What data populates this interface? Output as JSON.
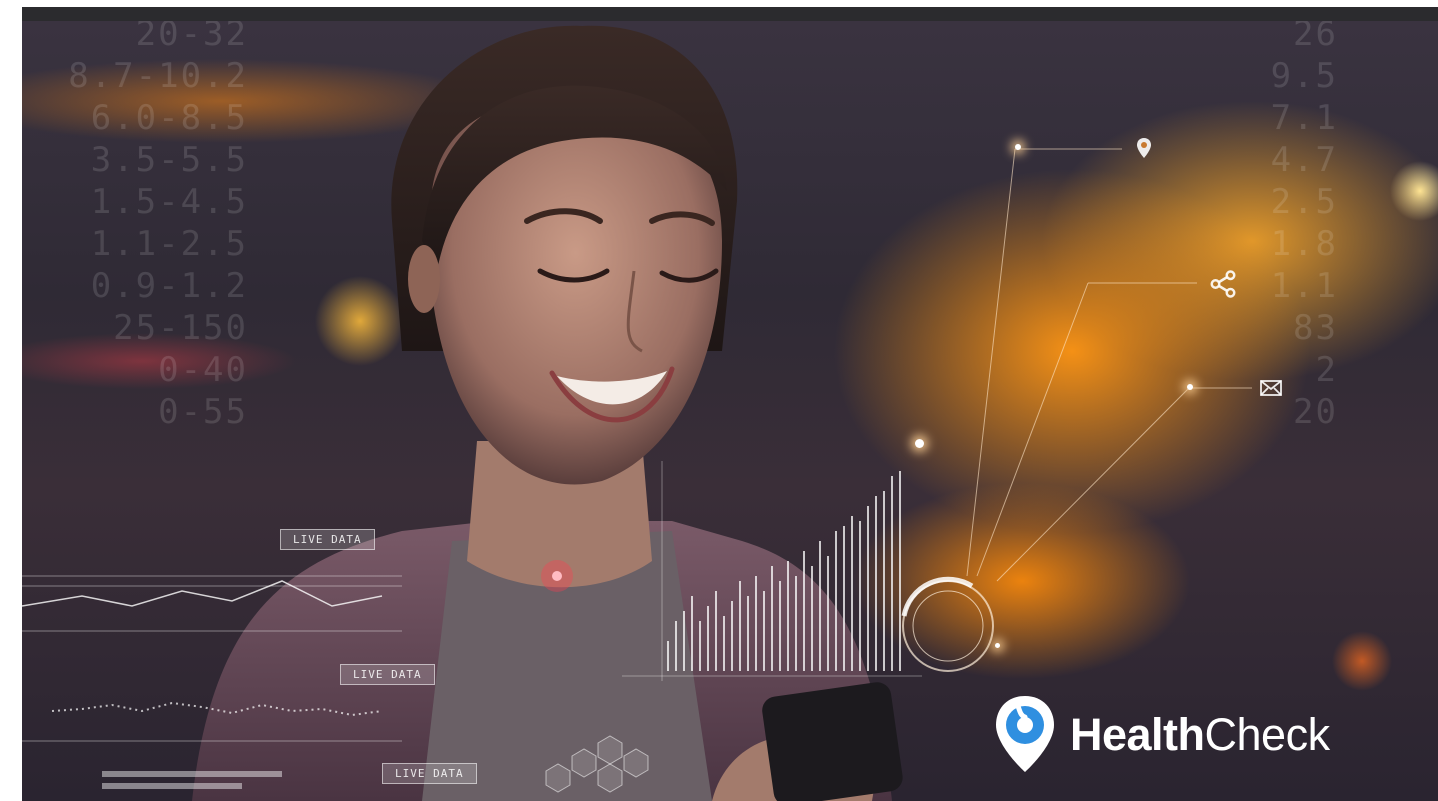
{
  "overlay": {
    "live_labels": [
      "LIVE DATA",
      "LIVE DATA",
      "LIVE DATA"
    ],
    "left_numbers": "20-32\n8.7-10.2\n6.0-8.5\n3.5-5.5\n1.5-4.5\n1.1-2.5\n0.9-1.2\n25-150\n0-40\n0-55",
    "right_numbers": "26\n9.5\n7.1\n4.7\n2.5\n1.8\n1.1\n83\n2\n20",
    "icons": [
      "map-pin-icon",
      "share-icon",
      "mail-icon"
    ]
  },
  "logo": {
    "name_bold": "Health",
    "name_regular": "Check",
    "colors": {
      "pin_blue": "#2f8fe0",
      "text": "#ffffff"
    }
  }
}
